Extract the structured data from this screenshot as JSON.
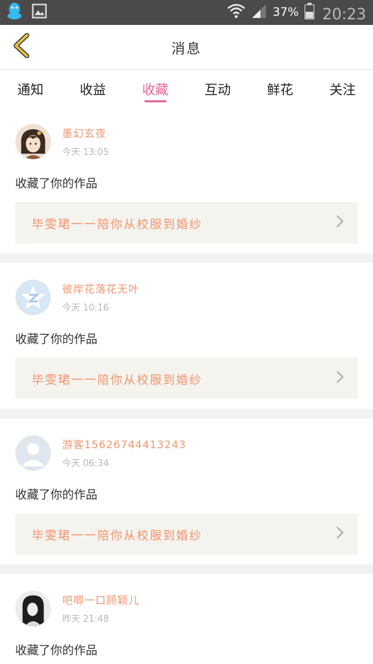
{
  "status_bar": {
    "battery_percent": "37%",
    "time": "20:23",
    "icons": [
      "qq-icon",
      "image-icon",
      "wifi-icon",
      "signal-icon",
      "battery-icon"
    ]
  },
  "header": {
    "title": "消息",
    "back_icon": "chevron-left-icon"
  },
  "tabs": [
    {
      "label": "通知",
      "active": false
    },
    {
      "label": "收益",
      "active": false
    },
    {
      "label": "收藏",
      "active": true
    },
    {
      "label": "互动",
      "active": false
    },
    {
      "label": "鲜花",
      "active": false
    },
    {
      "label": "关注",
      "active": false
    }
  ],
  "notifications": [
    {
      "username": "墨幻玄夜",
      "time": "今天 13:05",
      "action": "收藏了你的作品",
      "work_title": "毕雯珺一一陪你从校服到婚纱",
      "avatar": "anime-character-avatar"
    },
    {
      "username": "彼岸花落花无叶",
      "time": "今天 10:16",
      "action": "收藏了你的作品",
      "work_title": "毕雯珺一一陪你从校服到婚纱",
      "avatar": "qzone-star-avatar"
    },
    {
      "username": "游客15626744413243",
      "time": "今天 06:34",
      "action": "收藏了你的作品",
      "work_title": "毕雯珺一一陪你从校服到婚纱",
      "avatar": "default-user-avatar"
    },
    {
      "username": "吧唧一口顾颖儿",
      "time": "昨天 21:48",
      "action": "收藏了你的作品",
      "avatar": "photo-avatar"
    }
  ],
  "colors": {
    "accent_pink": "#e2679a",
    "username_orange": "#f0966e",
    "work_bg": "#f4f3ee",
    "status_bar_bg": "#4a4a4a",
    "back_arrow": "#e8c23c"
  }
}
